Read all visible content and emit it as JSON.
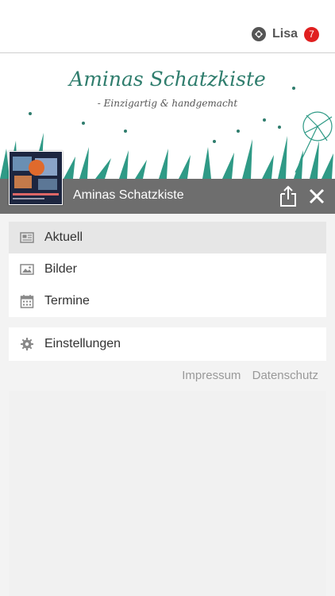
{
  "header": {
    "user_name": "Lisa",
    "notification_count": "7"
  },
  "banner": {
    "title": "Aminas Schatzkiste",
    "subtitle": "- Einzigartig & handgemacht"
  },
  "page": {
    "title": "Aminas Schatzkiste"
  },
  "menu": {
    "items": [
      {
        "label": "Aktuell",
        "icon": "newspaper-icon"
      },
      {
        "label": "Bilder",
        "icon": "image-icon"
      },
      {
        "label": "Termine",
        "icon": "calendar-icon"
      }
    ],
    "settings_label": "Einstellungen"
  },
  "footer": {
    "impressum": "Impressum",
    "datenschutz": "Datenschutz"
  },
  "colors": {
    "accent": "#2f7d6d",
    "badge": "#e02020",
    "titlebar": "#6e6e6e"
  }
}
